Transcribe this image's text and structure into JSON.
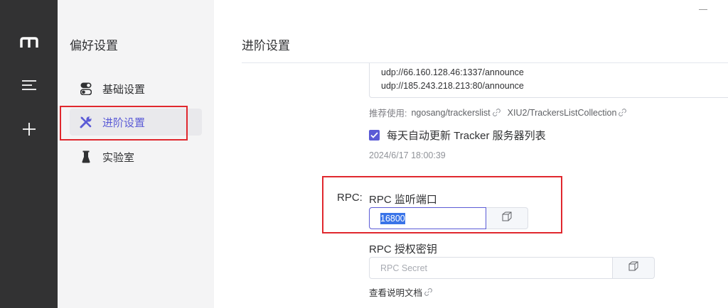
{
  "rail": {
    "items": [
      {
        "name": "app-logo-icon"
      },
      {
        "name": "menu-icon"
      },
      {
        "name": "add-task-icon"
      }
    ]
  },
  "nav": {
    "title": "偏好设置",
    "items": [
      {
        "label": "基础设置",
        "icon": "toggle-icon"
      },
      {
        "label": "进阶设置",
        "icon": "tools-icon",
        "active": true
      },
      {
        "label": "实验室",
        "icon": "flask-icon"
      }
    ]
  },
  "main": {
    "title": "进阶设置",
    "tracker_lines": [
      "udp://66.160.128.46:1337/announce",
      "udp://185.243.218.213:80/announce"
    ],
    "recommend_label": "推荐使用:",
    "recommend_links": [
      "ngosang/trackerslist",
      "XIU2/TrackersListCollection"
    ],
    "auto_update_label": "每天自动更新 Tracker 服务器列表",
    "auto_update_checked": true,
    "last_update": "2024/6/17 18:00:39",
    "rpc_section_label": "RPC:",
    "rpc_port_label": "RPC 监听端口",
    "rpc_port_value": "16800",
    "rpc_secret_label": "RPC 授权密钥",
    "rpc_secret_placeholder": "RPC Secret",
    "doc_link_label": "查看说明文档"
  },
  "colors": {
    "accent": "#5b5bd6",
    "rail_bg": "#323233",
    "nav_bg": "#f4f4f5",
    "highlight_box": "#e0282e"
  }
}
